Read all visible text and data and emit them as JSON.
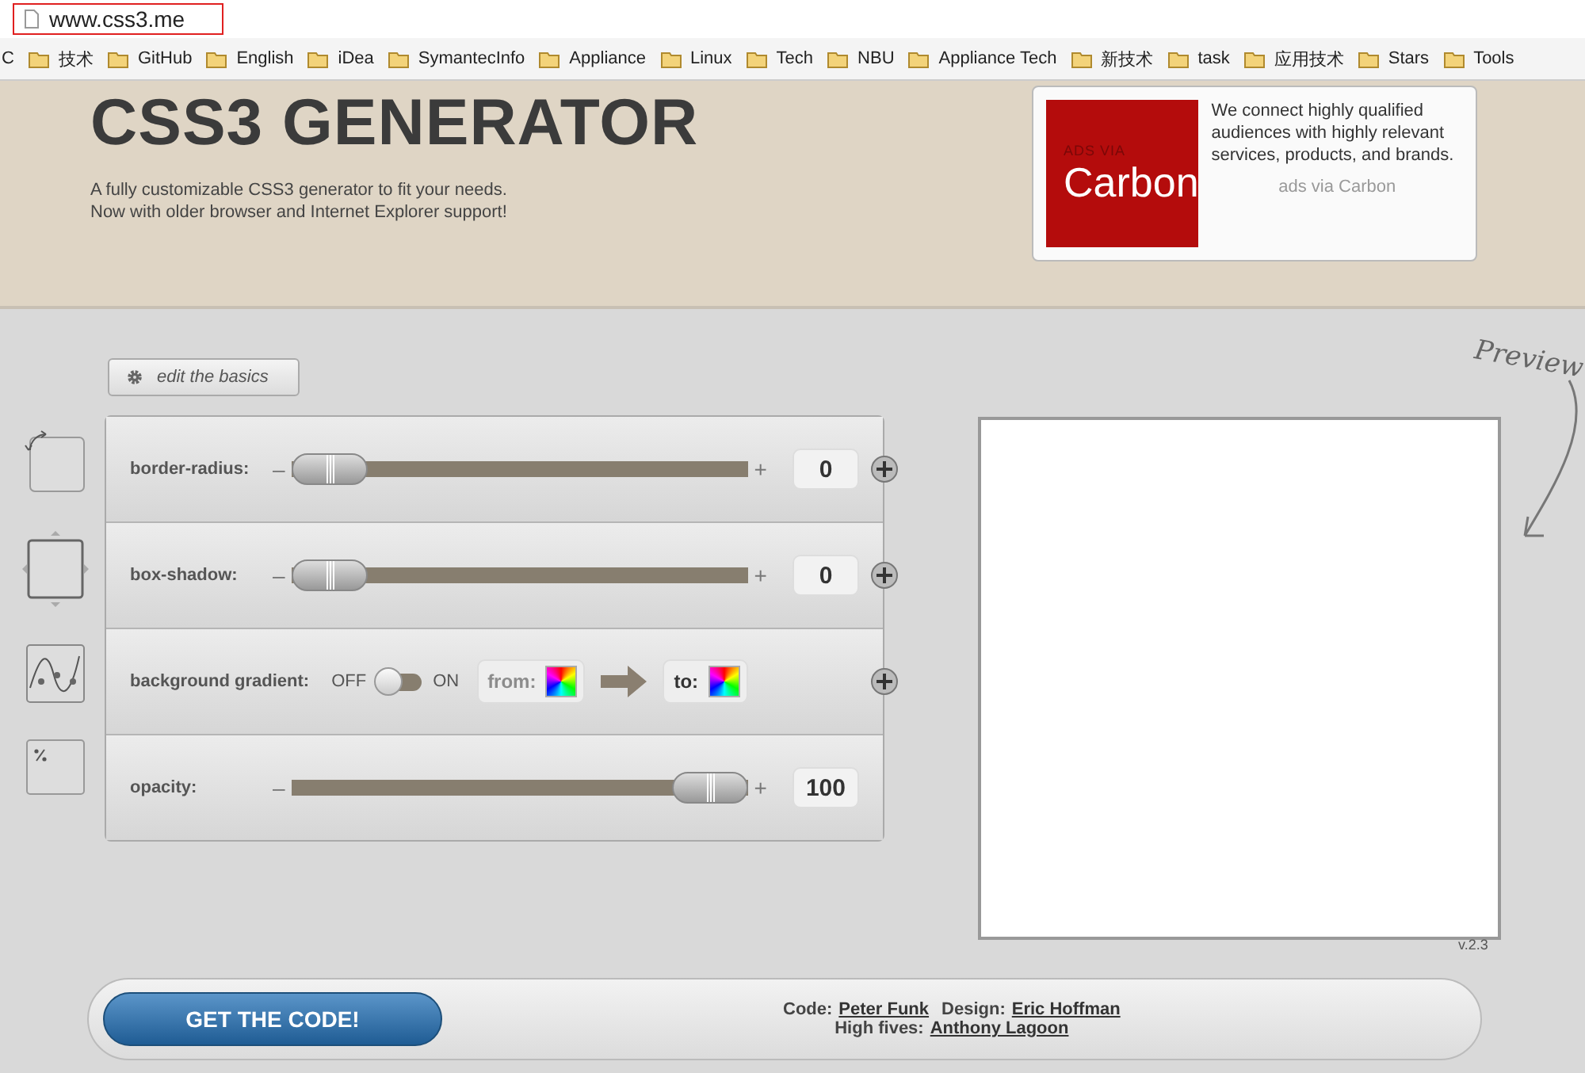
{
  "address_bar": {
    "url": "www.css3.me"
  },
  "bookmarks_cut_text": "C",
  "bookmarks": [
    {
      "label": "技术"
    },
    {
      "label": "GitHub"
    },
    {
      "label": "English"
    },
    {
      "label": "iDea"
    },
    {
      "label": "SymantecInfo"
    },
    {
      "label": "Appliance"
    },
    {
      "label": "Linux"
    },
    {
      "label": "Tech"
    },
    {
      "label": "NBU"
    },
    {
      "label": "Appliance Tech"
    },
    {
      "label": "新技术"
    },
    {
      "label": "task"
    },
    {
      "label": "应用技术"
    },
    {
      "label": "Stars"
    },
    {
      "label": "Tools"
    }
  ],
  "header": {
    "title": "CSS3 GENERATOR",
    "tagline": [
      "A fully customizable CSS3 generator to fit your needs.",
      "Now with older browser and Internet Explorer support!"
    ]
  },
  "ad": {
    "logo_small": "ADS VIA",
    "logo": "Carbon",
    "text": "We connect highly qualified audiences with highly relevant services, products, and brands.",
    "link": "ads via Carbon"
  },
  "edit_button": "edit the basics",
  "controls": [
    {
      "kind": "slider",
      "label": "border-radius:",
      "minus": "–",
      "plus": "+",
      "level": 0,
      "value": "0",
      "expand": true
    },
    {
      "kind": "slider",
      "label": "box-shadow:",
      "minus": "–",
      "plus": "+",
      "level": 0,
      "value": "0",
      "expand": true
    },
    {
      "kind": "toggle",
      "label": "background gradient:",
      "off_label": "OFF",
      "on_label": "ON",
      "on": false,
      "from_label": "from:",
      "to_label": "to:",
      "expand": true
    },
    {
      "kind": "slider",
      "label": "opacity:",
      "minus": "–",
      "plus": "+",
      "level": 1,
      "value": "100",
      "expand": false
    }
  ],
  "preview": {
    "label": "Preview",
    "version": "v.2.3"
  },
  "footer": {
    "button": "GET THE CODE!",
    "credits": [
      [
        {
          "prefix": "Code:",
          "name": "Peter Funk"
        },
        {
          "prefix": "Design:",
          "name": "Eric Hoffman"
        }
      ],
      [
        {
          "prefix": "High fives:",
          "name": "Anthony Lagoon"
        }
      ]
    ]
  }
}
